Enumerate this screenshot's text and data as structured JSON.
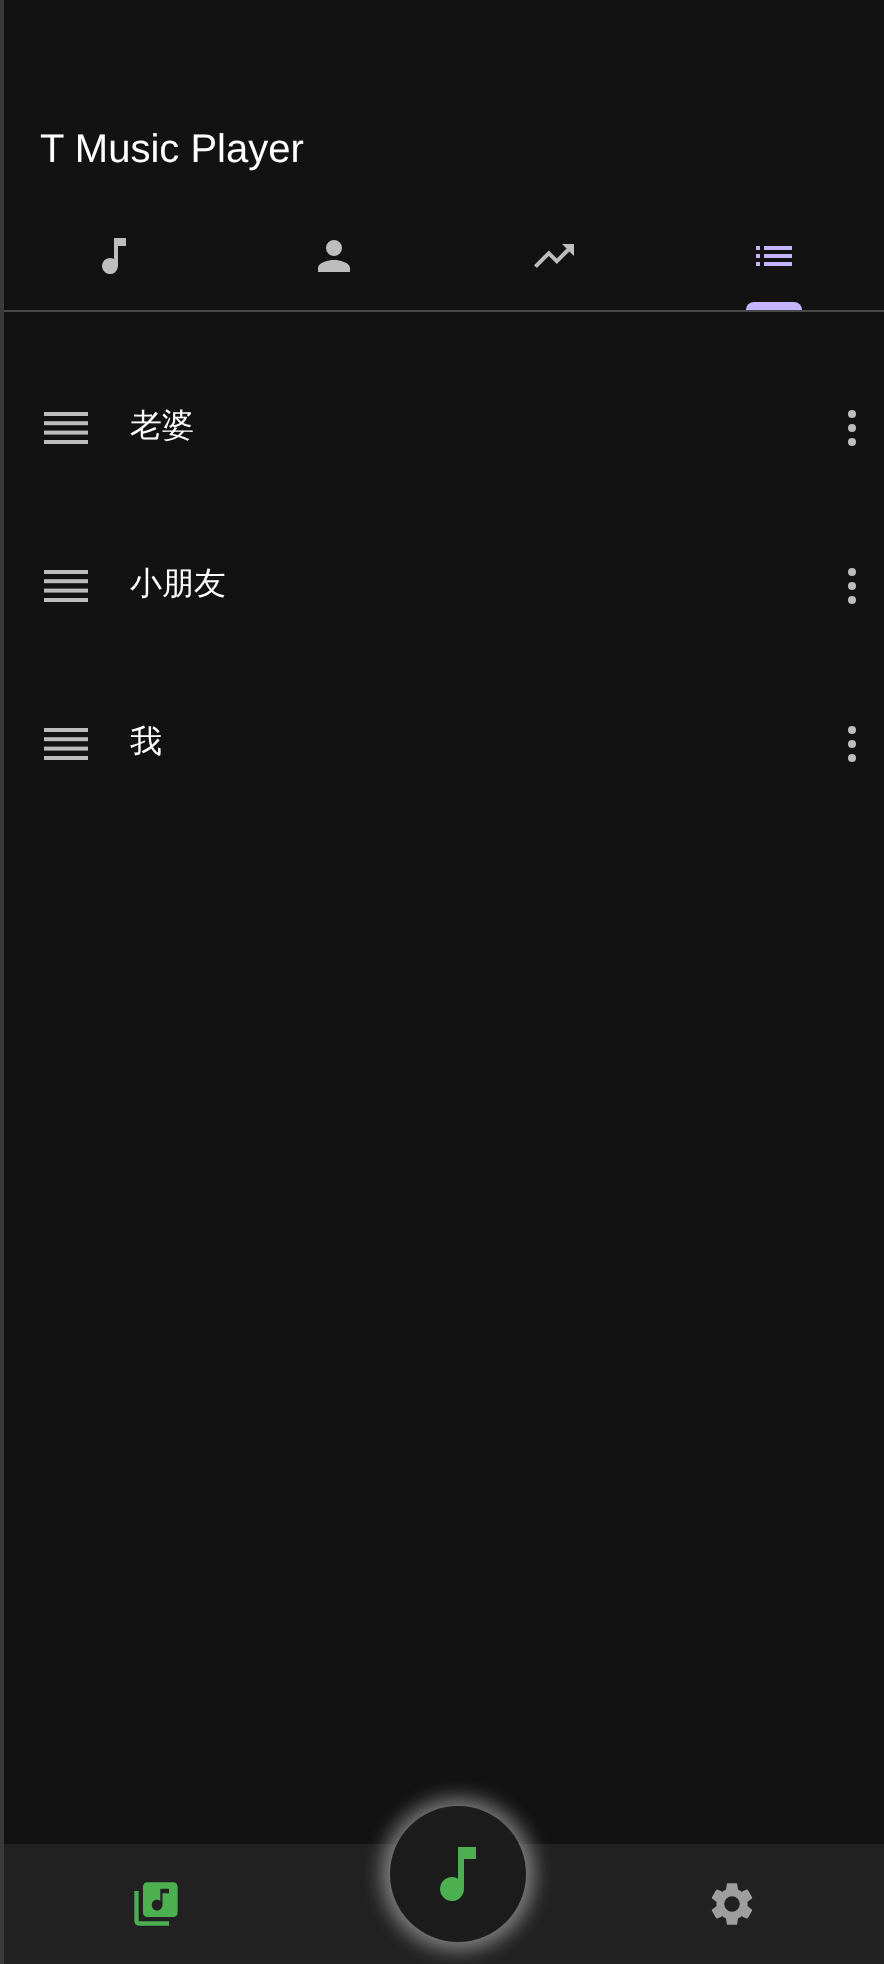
{
  "app_bar": {
    "title": "T Music Player"
  },
  "tabs": [
    {
      "kind": "songs",
      "selected": false
    },
    {
      "kind": "artists",
      "selected": false
    },
    {
      "kind": "trending",
      "selected": false
    },
    {
      "kind": "playlists",
      "selected": true
    }
  ],
  "playlists": [
    {
      "name": "老婆"
    },
    {
      "name": "小朋友"
    },
    {
      "name": "我"
    }
  ],
  "bottom_nav": [
    {
      "kind": "library",
      "selected": true
    },
    {
      "kind": "settings",
      "selected": false
    }
  ]
}
